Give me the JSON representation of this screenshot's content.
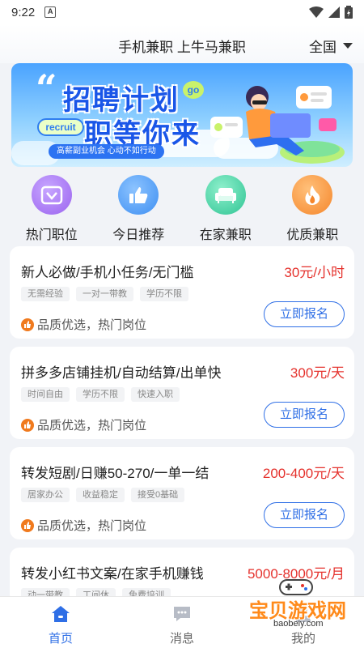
{
  "status": {
    "time": "9:22",
    "app_badge": "A"
  },
  "header": {
    "title": "手机兼职 上牛马兼职",
    "region": "全国"
  },
  "banner": {
    "line1": "招聘计划",
    "line2": "职等你来",
    "go": "go",
    "recruit": "recruit",
    "subtitle": "高薪副业机会 心动不如行动"
  },
  "categories": [
    {
      "label": "热门职位",
      "icon": "heart-badge-icon",
      "color": "#a06cf0"
    },
    {
      "label": "今日推荐",
      "icon": "thumbs-up-icon",
      "color": "#3e8ff2"
    },
    {
      "label": "在家兼职",
      "icon": "sofa-icon",
      "color": "#35c79a"
    },
    {
      "label": "优质兼职",
      "icon": "flame-icon",
      "color": "#f5862b"
    }
  ],
  "jobs": [
    {
      "title": "新人必做/手机小任务/无门槛",
      "salary": "30元/小时",
      "tags": [
        "无需经验",
        "一对一带教",
        "学历不限"
      ],
      "quality": "品质优选，热门岗位",
      "apply": "立即报名"
    },
    {
      "title": "拼多多店铺挂机/自动结算/出单快",
      "salary": "300元/天",
      "tags": [
        "时间自由",
        "学历不限",
        "快速入职"
      ],
      "quality": "品质优选，热门岗位",
      "apply": "立即报名"
    },
    {
      "title": "转发短剧/日赚50-270/一单一结",
      "salary": "200-400元/天",
      "tags": [
        "居家办公",
        "收益稳定",
        "接受0基础"
      ],
      "quality": "品质优选，热门岗位",
      "apply": "立即报名"
    },
    {
      "title": "转发小红书文案/在家手机赚钱",
      "salary": "5000-8000元/月",
      "tags": [
        "动一带教",
        "工间休",
        "免费培训"
      ],
      "quality": "",
      "apply": ""
    }
  ],
  "tabs": [
    {
      "label": "首页",
      "icon": "home-icon",
      "active": true
    },
    {
      "label": "消息",
      "icon": "chat-icon",
      "active": false
    },
    {
      "label": "我的",
      "icon": "profile-icon",
      "active": false
    }
  ],
  "watermark": {
    "text": "宝贝游戏网",
    "domain": "baobeiy.com"
  },
  "colors": {
    "accent": "#2f6fe6",
    "salary": "#e5322d"
  }
}
